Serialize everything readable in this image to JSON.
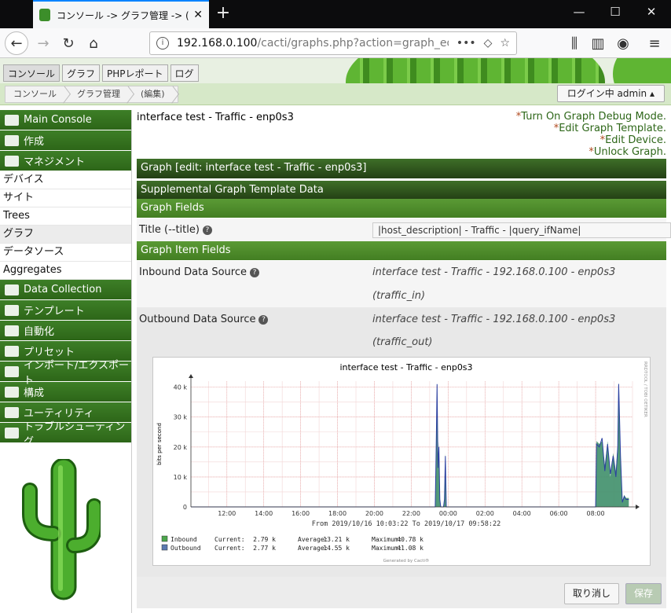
{
  "browser": {
    "tab_title": "コンソール -> グラフ管理 -> (編集)",
    "tab_close": "✕",
    "new_tab": "+",
    "url_host": "192.168.0.100",
    "url_path": "/cacti/graphs.php?action=graph_edit&",
    "url_more": "•••"
  },
  "app_tabs": [
    "コンソール",
    "グラフ",
    "PHPレポート",
    "ログ"
  ],
  "breadcrumbs": [
    "コンソール",
    "グラフ管理",
    "(編集)"
  ],
  "login_label": "ログイン中 admin ▴",
  "sidebar": {
    "sections": [
      {
        "label": "Main Console",
        "icon": "map-icon"
      },
      {
        "label": "作成",
        "icon": "chart-icon"
      },
      {
        "label": "マネジメント",
        "icon": "home-icon"
      }
    ],
    "management_items": [
      "デバイス",
      "サイト",
      "Trees",
      "グラフ",
      "データソース",
      "Aggregates"
    ],
    "more_sections": [
      {
        "label": "Data Collection",
        "icon": "database-icon"
      },
      {
        "label": "テンプレート",
        "icon": "template-icon"
      },
      {
        "label": "自動化",
        "icon": "refresh-icon"
      },
      {
        "label": "プリセット",
        "icon": "archive-icon"
      },
      {
        "label": "インポート/エクスポート",
        "icon": "exchange-icon"
      },
      {
        "label": "構成",
        "icon": "sliders-icon"
      },
      {
        "label": "ユーティリティ",
        "icon": "cogs-icon"
      },
      {
        "label": "トラブルシューティング",
        "icon": "bug-icon"
      }
    ]
  },
  "main": {
    "graph_title": "interface test - Traffic - enp0s3",
    "links": [
      "Turn On Graph Debug Mode.",
      "Edit Graph Template.",
      "Edit Device.",
      "Unlock Graph."
    ],
    "link_star": "*",
    "header_edit": "Graph [edit: interface test - Traffic - enp0s3]",
    "header_supp": "Supplemental Graph Template Data",
    "header_fields": "Graph Fields",
    "title_label": "Title (--title)",
    "title_value": "|host_description| - Traffic - |query_ifName|",
    "header_items": "Graph Item Fields",
    "inbound_label": "Inbound Data Source",
    "inbound_value": "interface test - Traffic - 192.168.0.100 - enp0s3",
    "inbound_sub": "(traffic_in)",
    "outbound_label": "Outbound Data Source",
    "outbound_value": "interface test - Traffic - 192.168.0.100 - enp0s3",
    "outbound_sub": "(traffic_out)",
    "help_mark": "?"
  },
  "footer": {
    "cancel": "取り消し",
    "save": "保存"
  },
  "chart_data": {
    "type": "area",
    "title": "interface test - Traffic - enp0s3",
    "ylabel": "bits per second",
    "side_text": "RRDTOOL / TOBI OETIKER",
    "range_text": "From 2019/10/16 10:03:22 To 2019/10/17 09:58:22",
    "y_ticks": [
      "0",
      "10 k",
      "20 k",
      "30 k",
      "40 k"
    ],
    "ylim": [
      0,
      42000
    ],
    "x_ticks": [
      "12:00",
      "14:00",
      "16:00",
      "18:00",
      "20:00",
      "22:00",
      "00:00",
      "02:00",
      "04:00",
      "06:00",
      "08:00"
    ],
    "x_hours_ticks": [
      12,
      14,
      16,
      18,
      20,
      22,
      24,
      26,
      28,
      30,
      32
    ],
    "xlim": [
      10.05,
      34.0
    ],
    "grid": true,
    "series": [
      {
        "name": "Inbound",
        "color": "#4ca64c",
        "x": [
          10.05,
          23.3,
          23.35,
          23.4,
          23.45,
          23.5,
          23.55,
          23.6,
          23.65,
          23.7,
          23.75,
          23.8,
          23.85,
          23.9,
          23.95,
          24.0,
          24.05,
          24.1,
          24.15,
          24.2,
          24.25,
          24.3,
          32.0,
          32.05,
          32.2,
          32.35,
          32.5,
          32.65,
          32.8,
          32.95,
          33.1,
          33.2,
          33.25,
          33.35,
          33.45,
          33.55,
          33.65,
          33.8
        ],
        "y": [
          0,
          0,
          21000,
          40800,
          12000,
          22000,
          3000,
          0,
          0,
          0,
          0,
          3000,
          18000,
          0,
          0,
          0,
          0,
          0,
          0,
          0,
          0,
          0,
          0,
          22000,
          21000,
          22000,
          14000,
          22000,
          10000,
          18000,
          12000,
          21000,
          40000,
          18000,
          2000,
          4000,
          3000,
          3000
        ]
      },
      {
        "name": "Outbound",
        "color": "#5c7ab0",
        "x": [
          10.05,
          23.3,
          23.35,
          23.4,
          23.45,
          23.5,
          23.55,
          23.6,
          23.65,
          23.7,
          23.75,
          23.8,
          23.85,
          23.9,
          23.95,
          24.0,
          24.05,
          24.1,
          24.15,
          24.2,
          24.25,
          24.3,
          32.0,
          32.05,
          32.2,
          32.35,
          32.5,
          32.65,
          32.8,
          32.95,
          33.1,
          33.2,
          33.25,
          33.35,
          33.45,
          33.55,
          33.65,
          33.8
        ],
        "y": [
          0,
          0,
          19000,
          41000,
          13000,
          20000,
          2500,
          0,
          0,
          0,
          0,
          2500,
          17000,
          0,
          0,
          0,
          0,
          0,
          0,
          0,
          0,
          0,
          0,
          21000,
          20000,
          23000,
          12000,
          21000,
          11000,
          17000,
          10000,
          20000,
          41080,
          17000,
          1500,
          3500,
          2500,
          2500
        ]
      }
    ],
    "legend": [
      {
        "name": "Inbound",
        "current": "2.79 k",
        "average": "13.21 k",
        "maximum": "40.78 k"
      },
      {
        "name": "Outbound",
        "current": "2.77 k",
        "average": "14.55 k",
        "maximum": "41.08 k"
      }
    ],
    "legend_labels": {
      "current": "Current:",
      "average": "Average:",
      "maximum": "Maximum:"
    },
    "credit": "Generated by Cacti®"
  }
}
